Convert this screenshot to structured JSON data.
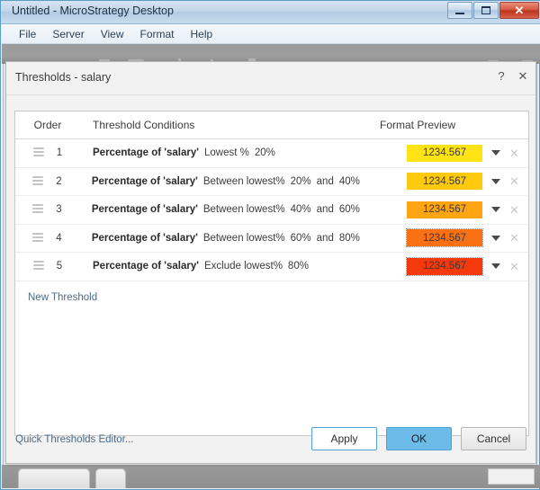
{
  "window": {
    "title": "Untitled - MicroStrategy Desktop",
    "controls": {
      "minimize": "minimize",
      "maximize": "maximize",
      "close": "✕"
    }
  },
  "menubar": {
    "items": [
      {
        "label": "File"
      },
      {
        "label": "Server"
      },
      {
        "label": "View"
      },
      {
        "label": "Format"
      },
      {
        "label": "Help"
      }
    ]
  },
  "dialog": {
    "title": "Thresholds - salary",
    "help_label": "?",
    "close_label": "✕",
    "table": {
      "columns": {
        "order": "Order",
        "conditions": "Threshold Conditions",
        "preview": "Format Preview"
      },
      "rows": [
        {
          "order": "1",
          "metric": "Percentage of 'salary'",
          "operator": "Lowest %",
          "value": "20%",
          "value2": "",
          "conjunction": "",
          "preview_text": "1234.567",
          "preview_color": "#FFE314",
          "selected": false
        },
        {
          "order": "2",
          "metric": "Percentage of 'salary'",
          "operator": "Between lowest%",
          "value": "20%",
          "conjunction": "and",
          "value2": "40%",
          "preview_text": "1234.567",
          "preview_color": "#FFC90E",
          "selected": false
        },
        {
          "order": "3",
          "metric": "Percentage of 'salary'",
          "operator": "Between lowest%",
          "value": "40%",
          "conjunction": "and",
          "value2": "60%",
          "preview_text": "1234.567",
          "preview_color": "#FFA412",
          "selected": false
        },
        {
          "order": "4",
          "metric": "Percentage of 'salary'",
          "operator": "Between lowest%",
          "value": "60%",
          "conjunction": "and",
          "value2": "80%",
          "preview_text": "1234.567",
          "preview_color": "#FA7014",
          "selected": true
        },
        {
          "order": "5",
          "metric": "Percentage of 'salary'",
          "operator": "Exclude lowest%",
          "value": "80%",
          "conjunction": "",
          "value2": "",
          "preview_text": "1234.567",
          "preview_color": "#F43A0D",
          "selected": true
        }
      ],
      "row_delete_label": "✕"
    },
    "new_threshold_label": "New Threshold",
    "footer": {
      "quick_editor_label": "Quick Thresholds Editor...",
      "apply_label": "Apply",
      "ok_label": "OK",
      "cancel_label": "Cancel"
    }
  },
  "colors": {
    "link": "#4a6c8a",
    "primary_button": "#6cbbe8",
    "accent_border": "#4fa3d8"
  }
}
